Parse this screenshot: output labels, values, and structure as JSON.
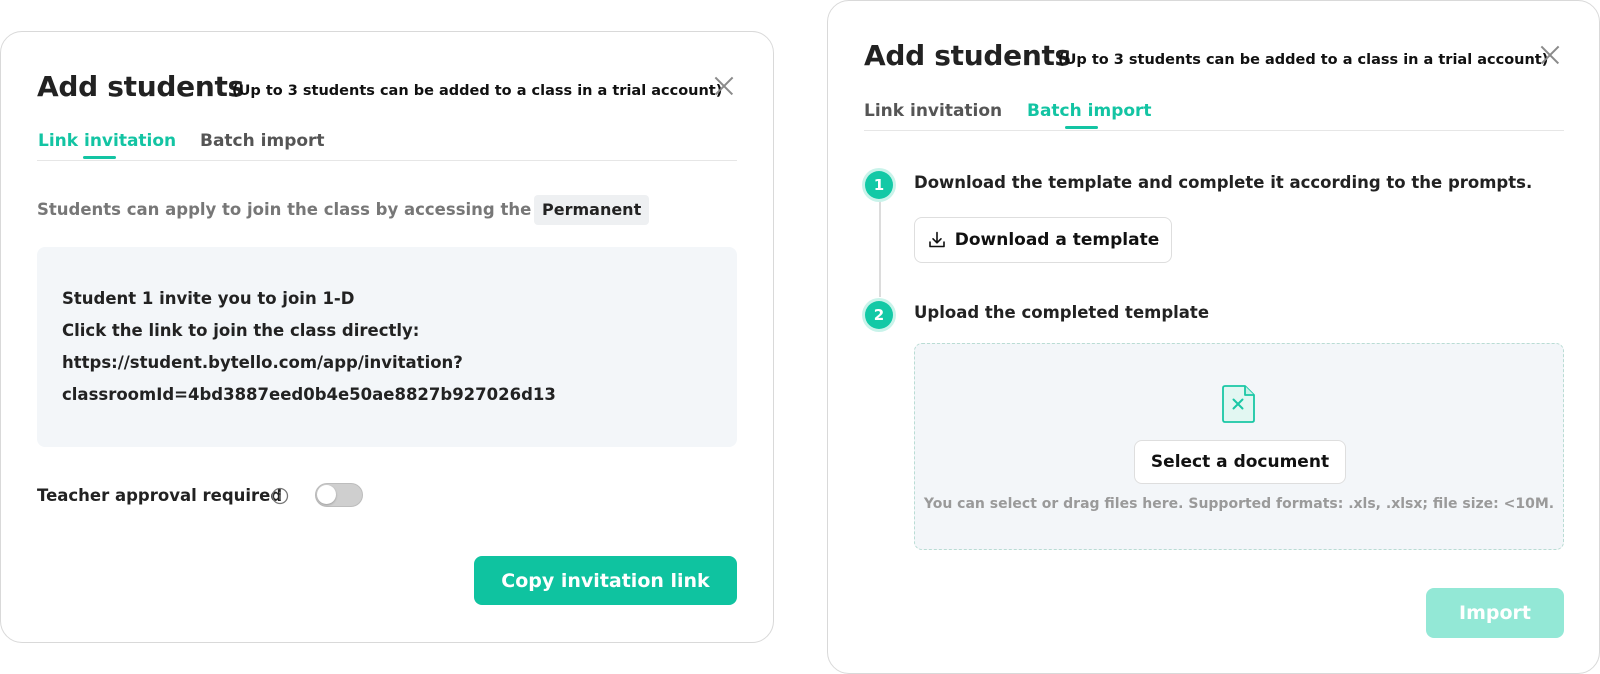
{
  "link_dialog": {
    "title": "Add students",
    "subtitle": "(Up to 3 students can be added to a class in a trial account)",
    "tabs": [
      {
        "label": "Link invitation",
        "active": true
      },
      {
        "label": "Batch import",
        "active": false
      }
    ],
    "description": "Students can apply to join the class by accessing the link",
    "validity_badge": "Permanent",
    "invite_lines": [
      "Student 1 invite you to join 1-D",
      "Click the link to join the class directly:",
      "https://student.bytello.com/app/invitation?",
      "classroomId=4bd3887eed0b4e50ae8827b927026d13"
    ],
    "approval_label": "Teacher approval required",
    "approval_enabled": false,
    "copy_button": "Copy invitation link"
  },
  "batch_dialog": {
    "title": "Add students",
    "subtitle": "(Up to 3 students can be added to a class in a trial account)",
    "tabs": [
      {
        "label": "Link invitation",
        "active": false
      },
      {
        "label": "Batch import",
        "active": true
      }
    ],
    "steps": [
      {
        "number": "1",
        "text": "Download the template and complete it according to the prompts."
      },
      {
        "number": "2",
        "text": "Upload the completed template"
      }
    ],
    "download_button": "Download a template",
    "select_button": "Select a document",
    "drop_hint": "You can select or drag files here. Supported formats: .xls, .xlsx; file size: <10M.",
    "import_button": "Import",
    "import_enabled": false
  },
  "colors": {
    "accent": "#13c4a3",
    "accent_disabled": "#93e8d6"
  },
  "icons": [
    "close-icon",
    "info-icon",
    "download-icon",
    "excel-file-icon"
  ]
}
